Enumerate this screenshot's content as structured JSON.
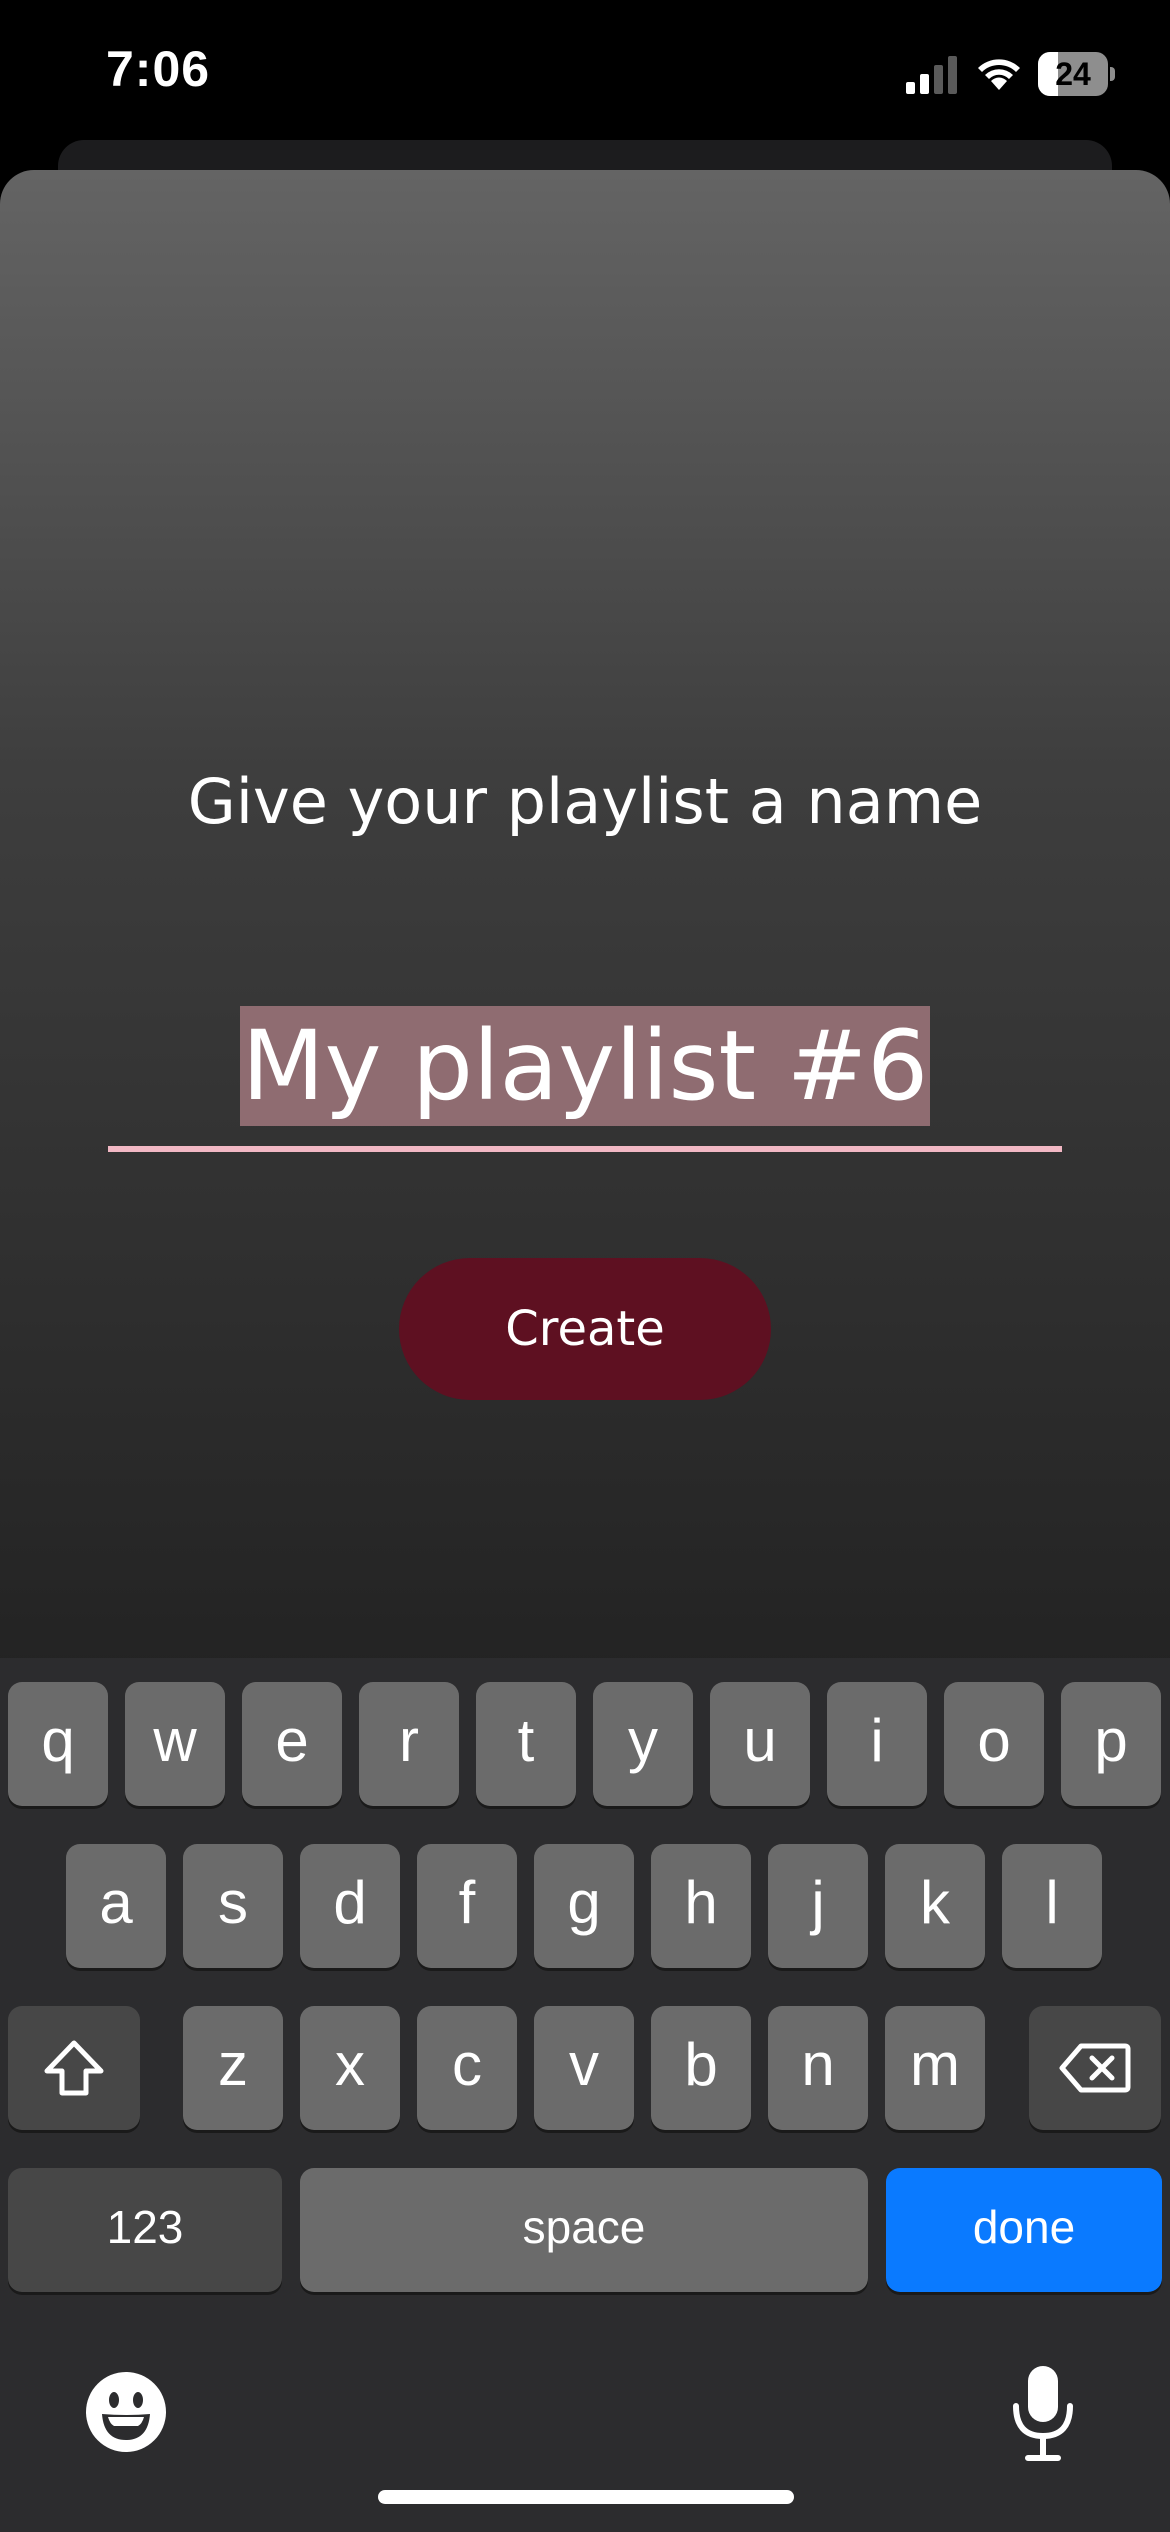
{
  "status_bar": {
    "time": "7:06",
    "battery": "24"
  },
  "sheet": {
    "title": "Give your playlist a name",
    "input_value": "My playlist #6",
    "create_label": "Create"
  },
  "keyboard": {
    "row1": [
      "q",
      "w",
      "e",
      "r",
      "t",
      "y",
      "u",
      "i",
      "o",
      "p"
    ],
    "row2": [
      "a",
      "s",
      "d",
      "f",
      "g",
      "h",
      "j",
      "k",
      "l"
    ],
    "row3": [
      "z",
      "x",
      "c",
      "v",
      "b",
      "n",
      "m"
    ],
    "numbers_label": "123",
    "space_label": "space",
    "done_label": "done"
  },
  "colors": {
    "accent": "#0a7aff",
    "create_button": "#5e1021",
    "underline": "#f2b8c4",
    "selection": "#8f6c71"
  }
}
